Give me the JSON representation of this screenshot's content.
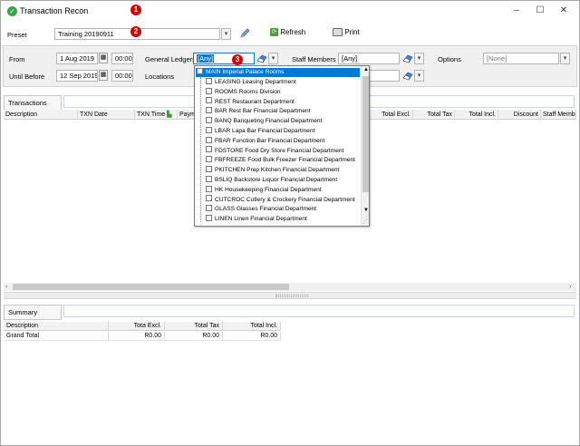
{
  "window": {
    "title": "Transaction Recon",
    "minimize": "–",
    "maximize": "☐",
    "close": "✕"
  },
  "markers": [
    "1",
    "2",
    "3"
  ],
  "toolbar": {
    "preset_label": "Preset",
    "preset_value": "Training 20190911",
    "refresh_label": "Refresh",
    "print_label": "Print"
  },
  "filters": {
    "from_label": "From",
    "from_date": "1 Aug 2019",
    "from_time": "00:00",
    "until_label": "Until Before",
    "until_date": "12 Sep 2019",
    "until_time": "00:00",
    "general_ledgers_label": "General Ledgers",
    "general_ledgers_value": "[Any]",
    "locations_label": "Locations",
    "staff_members_label": "Staff Members",
    "staff_members_value": "[Any]",
    "options_label": "Options",
    "options_value": "[None]"
  },
  "transactions": {
    "tab": "Transactions",
    "columns": [
      "Description",
      "TXN Date",
      "TXN Time",
      "Paymen",
      "Total Excl.",
      "Total Tax",
      "Total Incl.",
      "Discount",
      "Staff Membe"
    ]
  },
  "ledger_dropdown": {
    "root": "MAIN Imperial Palace Rooms",
    "items": [
      "LEASING Leasing Department",
      "ROOMS Rooms Division",
      "REST Restaurant Department",
      "BAR Rest Bar Financial Department",
      "BANQ Banqueting Financial Department",
      "LBAR Lapa Bar Financial Department",
      "FBAR Function Bar Financial Department",
      "FDSTORE Food Dry Store Financial Department",
      "FBFREEZE Food Bulk Freezer Financial Department",
      "PKITCHEN Prep Kitchen Financial Department",
      "BSLIQ Backstore Liquor Financial Department",
      "HK Housekeeping Financial Department",
      "CUTCROC Cutlery & Crockery Financial Department",
      "GLASS Glasses Financial Department",
      "LINEN Linen Financial Department"
    ]
  },
  "summary": {
    "tab": "Summary",
    "columns": [
      "Description",
      "Tota Excl.",
      "Total Tax",
      "Total Incl."
    ],
    "rows": [
      [
        "Grand Total",
        "R0.00",
        "R0.00",
        "R0.00"
      ]
    ]
  },
  "colors": {
    "accent": "#0078d7",
    "marker": "#d40000",
    "selected_row": "#0078d7"
  }
}
